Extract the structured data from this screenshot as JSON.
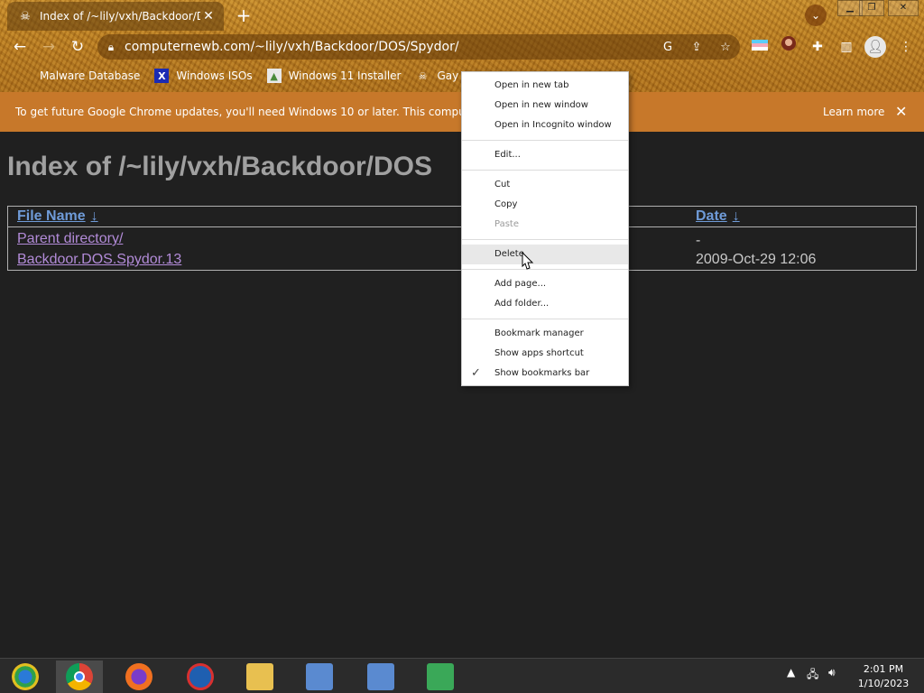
{
  "browser": {
    "tab_title": "Index of /~lily/vxh/Backdoor/DO",
    "tab_close": "✕",
    "new_tab": "+",
    "url": "computernewb.com/~lily/vxh/Backdoor/DOS/Spydor/",
    "bookmarks": [
      {
        "label": "Malware Database",
        "icon": "blank-icon"
      },
      {
        "label": "Windows ISOs",
        "icon": "x-icon"
      },
      {
        "label": "Windows 11 Installer",
        "icon": "image-icon"
      },
      {
        "label": "Gay Porn Sex ...",
        "icon": "skull-icon"
      }
    ]
  },
  "infobar": {
    "message": "To get future Google Chrome updates, you'll need Windows 10 or later. This computer is",
    "learn_more": "Learn more",
    "close": "✕"
  },
  "page": {
    "heading": "Index of /~lily/vxh/Backdoor/DOS",
    "columns": {
      "name": "File Name",
      "date": "Date",
      "sort_arrow": "↓"
    },
    "rows": [
      {
        "name": "Parent directory/",
        "date": "-"
      },
      {
        "name": "Backdoor.DOS.Spydor.13",
        "date": "2009-Oct-29 12:06"
      }
    ]
  },
  "context_menu": {
    "items": [
      {
        "label": "Open in new tab",
        "disabled": false
      },
      {
        "label": "Open in new window",
        "disabled": false
      },
      {
        "label": "Open in Incognito window",
        "disabled": false
      },
      {
        "label": "Edit...",
        "disabled": false
      },
      {
        "label": "Cut",
        "disabled": false
      },
      {
        "label": "Copy",
        "disabled": false
      },
      {
        "label": "Paste",
        "disabled": true
      },
      {
        "label": "Delete",
        "disabled": false,
        "hovered": true
      },
      {
        "label": "Add page...",
        "disabled": false
      },
      {
        "label": "Add folder...",
        "disabled": false
      },
      {
        "label": "Bookmark manager",
        "disabled": false
      },
      {
        "label": "Show apps shortcut",
        "disabled": false
      },
      {
        "label": "Show bookmarks bar",
        "disabled": false,
        "checked": true
      }
    ]
  },
  "taskbar": {
    "time": "2:01 PM",
    "date": "1/10/2023"
  },
  "colors": {
    "theme_gold": "#b97b1f",
    "infobar": "#c7782a",
    "link_unvisited": "#6f9bd8",
    "link_visited": "#b28bd8",
    "page_bg": "#202020"
  }
}
